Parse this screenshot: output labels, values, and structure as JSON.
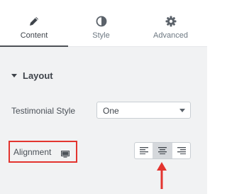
{
  "tabs": [
    {
      "label": "Content",
      "icon": "pencil-icon",
      "active": true
    },
    {
      "label": "Style",
      "icon": "half-circle-icon",
      "active": false
    },
    {
      "label": "Advanced",
      "icon": "gear-icon",
      "active": false
    }
  ],
  "section": {
    "title": "Layout"
  },
  "testimonial_style": {
    "label": "Testimonial Style",
    "value": "One"
  },
  "alignment": {
    "label": "Alignment",
    "device_icon": "desktop-icon",
    "options": [
      "align-left",
      "align-center",
      "align-right"
    ],
    "selected": "align-center"
  },
  "colors": {
    "highlight_box": "#e3342f",
    "annotation_arrow": "#e3342f",
    "selected_button": "#d5d8dc",
    "panel_bg": "#f1f2f3"
  }
}
